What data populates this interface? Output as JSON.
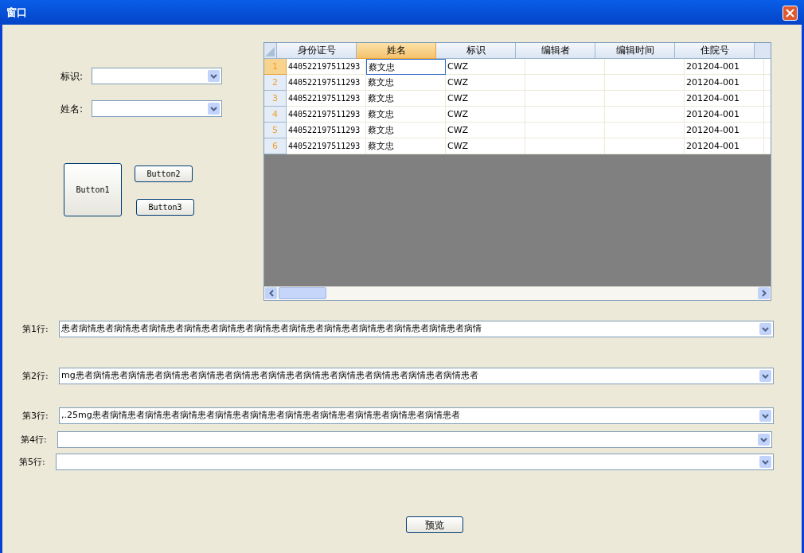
{
  "window": {
    "title": "窗口"
  },
  "filters": [
    {
      "label": "标识:"
    },
    {
      "label": "姓名:"
    }
  ],
  "buttons": [
    "Button1",
    "Button2",
    "Button3"
  ],
  "grid": {
    "columns": [
      {
        "label": "身份证号",
        "selected": false
      },
      {
        "label": "姓名",
        "selected": true
      },
      {
        "label": "标识",
        "selected": false
      },
      {
        "label": "编辑者",
        "selected": false
      },
      {
        "label": "编辑时间",
        "selected": false
      },
      {
        "label": "住院号",
        "selected": false
      }
    ],
    "rows": [
      {
        "number": "1",
        "selected": true,
        "cells": [
          "440522197511293",
          "蔡文忠",
          "CWZ",
          "",
          "",
          "201204-001"
        ]
      },
      {
        "number": "2",
        "selected": false,
        "cells": [
          "440522197511293",
          "蔡文忠",
          "CWZ",
          "",
          "",
          "201204-001"
        ]
      },
      {
        "number": "3",
        "selected": false,
        "cells": [
          "440522197511293",
          "蔡文忠",
          "CWZ",
          "",
          "",
          "201204-001"
        ]
      },
      {
        "number": "4",
        "selected": false,
        "cells": [
          "440522197511293",
          "蔡文忠",
          "CWZ",
          "",
          "",
          "201204-001"
        ]
      },
      {
        "number": "5",
        "selected": false,
        "cells": [
          "440522197511293",
          "蔡文忠",
          "CWZ",
          "",
          "",
          "201204-001"
        ]
      },
      {
        "number": "6",
        "selected": false,
        "cells": [
          "440522197511293",
          "蔡文忠",
          "CWZ",
          "",
          "",
          "201204-001"
        ]
      }
    ]
  },
  "lines": [
    {
      "label": "第1行:",
      "value": "患者病情患者病情患者病情患者病情患者病情患者病情患者病情患者病情患者病情患者病情患者病情患者病情"
    },
    {
      "label": "第2行:",
      "value": "mg患者病情患者病情患者病情患者病情患者病情患者病情患者病情患者病情患者病情患者病情患者病情患者"
    },
    {
      "label": "第3行:",
      "value": ",.25mg患者病情患者病情患者病情患者病情患者病情患者病情患者病情患者病情患者病情患者病情患者"
    },
    {
      "label": "第4行:"
    },
    {
      "label": "第5行:"
    }
  ],
  "preview_button": "预览"
}
